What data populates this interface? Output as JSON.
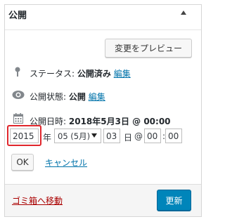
{
  "panel": {
    "title": "公開"
  },
  "preview_button": "変更をプレビュー",
  "status": {
    "label": "ステータス:",
    "value": "公開済み",
    "edit": "編集"
  },
  "visibility": {
    "label": "公開状態:",
    "value": "公開",
    "edit": "編集"
  },
  "publish_date": {
    "label": "公開日時:",
    "value": "2018年5月3日 @ 00:00"
  },
  "date_editor": {
    "year": "2015",
    "year_unit": "年",
    "month": "05 (5月)",
    "day": "03",
    "day_unit": "日",
    "at": "@",
    "hour": "00",
    "colon": ":",
    "minute": "00",
    "ok": "OK",
    "cancel": "キャンセル"
  },
  "footer": {
    "trash": "ゴミ箱へ移動",
    "update": "更新"
  },
  "colors": {
    "link": "#0073aa",
    "primary": "#0085ba",
    "trash": "#aa0000",
    "highlight": "#e0262c"
  }
}
